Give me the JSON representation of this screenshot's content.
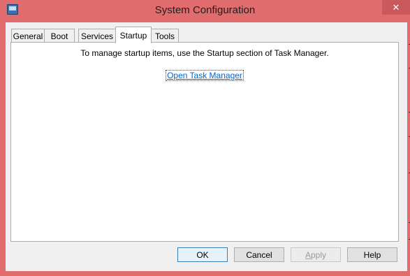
{
  "window": {
    "title": "System Configuration",
    "close_glyph": "✕",
    "icon": "system-configuration-icon"
  },
  "tabs": [
    {
      "label": "General"
    },
    {
      "label": "Boot"
    },
    {
      "label": "Services"
    },
    {
      "label": "Startup",
      "active": true
    },
    {
      "label": "Tools"
    }
  ],
  "startup": {
    "message": "To manage startup items, use the Startup section of Task Manager.",
    "link_label": "Open Task Manager"
  },
  "buttons": {
    "ok": "OK",
    "cancel": "Cancel",
    "apply_first": "A",
    "apply_rest": "pply",
    "help": "Help"
  },
  "colors": {
    "titlebar": "#e06c6e",
    "link": "#0066cc",
    "dialog": "#f0f0f0"
  }
}
